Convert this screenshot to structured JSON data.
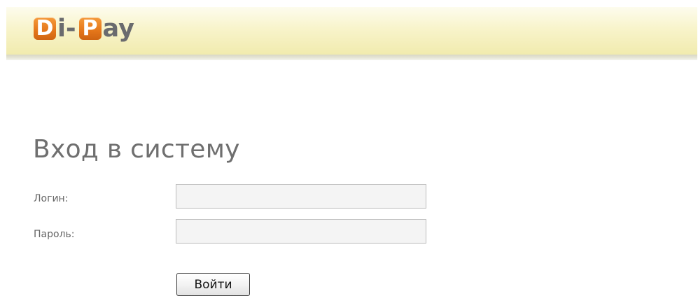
{
  "header": {
    "logo": {
      "first_letter": "D",
      "first_rest": "i-",
      "second_letter": "P",
      "second_rest": "ay",
      "box_color": "#E4761A",
      "text_color": "#6A6B6E"
    },
    "background_color": "#F6F1C2"
  },
  "login": {
    "title": "Вход в систему",
    "login_label": "Логин:",
    "login_value": "",
    "password_label": "Пароль:",
    "password_value": "",
    "submit_label": "Войти"
  }
}
